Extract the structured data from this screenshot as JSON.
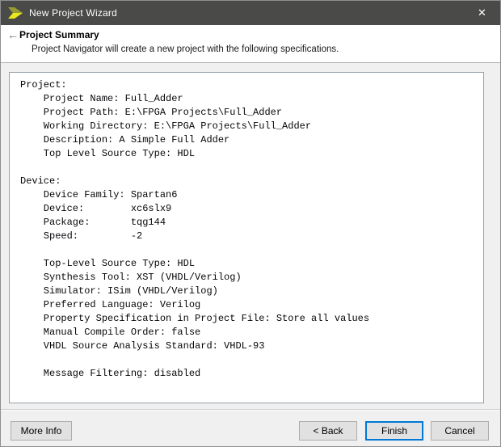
{
  "window": {
    "title": "New Project Wizard",
    "close_glyph": "✕"
  },
  "header": {
    "back_arrow_glyph": "←",
    "title": "Project Summary",
    "subtitle": "Project Navigator will create a new project with the following specifications."
  },
  "summary": {
    "lines": [
      "Project:",
      "    Project Name: Full_Adder",
      "    Project Path: E:\\FPGA Projects\\Full_Adder",
      "    Working Directory: E:\\FPGA Projects\\Full_Adder",
      "    Description: A Simple Full Adder",
      "    Top Level Source Type: HDL",
      "",
      "Device:",
      "    Device Family: Spartan6",
      "    Device:        xc6slx9",
      "    Package:       tqg144",
      "    Speed:         -2",
      "",
      "    Top-Level Source Type: HDL",
      "    Synthesis Tool: XST (VHDL/Verilog)",
      "    Simulator: ISim (VHDL/Verilog)",
      "    Preferred Language: Verilog",
      "    Property Specification in Project File: Store all values",
      "    Manual Compile Order: false",
      "    VHDL Source Analysis Standard: VHDL-93",
      "",
      "    Message Filtering: disabled"
    ]
  },
  "buttons": {
    "more_info": "More Info",
    "back": "< Back",
    "finish": "Finish",
    "cancel": "Cancel"
  },
  "colors": {
    "titlebar": "#4a4a48",
    "accent_default_button": "#0078d7",
    "icon_yellow_bright": "#e8e81e",
    "icon_yellow_olive": "#9a9a35"
  }
}
